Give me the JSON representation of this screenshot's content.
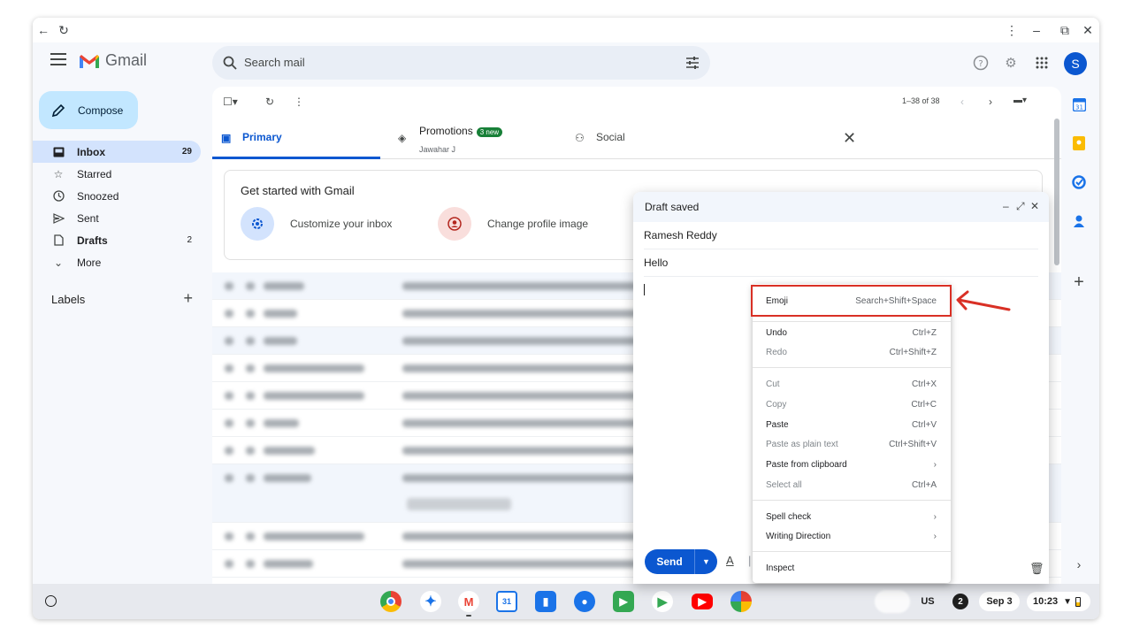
{
  "gmail": {
    "brand": "Gmail",
    "search_placeholder": "Search mail",
    "avatar_letter": "S"
  },
  "sidebar": {
    "compose_label": "Compose",
    "items": [
      {
        "label": "Inbox",
        "count": "29",
        "icon": "inbox-icon"
      },
      {
        "label": "Starred",
        "count": "",
        "icon": "star-icon"
      },
      {
        "label": "Snoozed",
        "count": "",
        "icon": "clock-icon"
      },
      {
        "label": "Sent",
        "count": "",
        "icon": "send-icon"
      },
      {
        "label": "Drafts",
        "count": "2",
        "icon": "draft-icon"
      },
      {
        "label": "More",
        "count": "",
        "icon": "chevron-down-icon"
      }
    ],
    "labels_heading": "Labels"
  },
  "toolbar": {
    "pager": "1–38 of 38"
  },
  "tabs": {
    "primary": "Primary",
    "promotions": "Promotions",
    "promotions_badge": "3 new",
    "promotions_sub": "Jawahar J",
    "social": "Social"
  },
  "get_started": {
    "title": "Get started with Gmail",
    "item1": "Customize your inbox",
    "item2": "Change profile image"
  },
  "compose_window": {
    "title": "Draft saved",
    "recipient": "Ramesh Reddy",
    "subject": "Hello",
    "send_label": "Send"
  },
  "context_menu": {
    "emoji": {
      "label": "Emoji",
      "shortcut": "Search+Shift+Space"
    },
    "undo": {
      "label": "Undo",
      "shortcut": "Ctrl+Z"
    },
    "redo": {
      "label": "Redo",
      "shortcut": "Ctrl+Shift+Z"
    },
    "cut": {
      "label": "Cut",
      "shortcut": "Ctrl+X"
    },
    "copy": {
      "label": "Copy",
      "shortcut": "Ctrl+C"
    },
    "paste": {
      "label": "Paste",
      "shortcut": "Ctrl+V"
    },
    "paste_plain": {
      "label": "Paste as plain text",
      "shortcut": "Ctrl+Shift+V"
    },
    "paste_clipboard": {
      "label": "Paste from clipboard",
      "shortcut": "›"
    },
    "select_all": {
      "label": "Select all",
      "shortcut": "Ctrl+A"
    },
    "spell_check": {
      "label": "Spell check",
      "shortcut": "›"
    },
    "writing_direction": {
      "label": "Writing Direction",
      "shortcut": "›"
    },
    "inspect": {
      "label": "Inspect",
      "shortcut": ""
    }
  },
  "shelf": {
    "input_method": "US",
    "notifications": "2",
    "date": "Sep 3",
    "time": "10:23"
  },
  "colors": {
    "accent": "#0b57d0",
    "compose_bg": "#c2e7ff",
    "highlight": "#d93025"
  }
}
